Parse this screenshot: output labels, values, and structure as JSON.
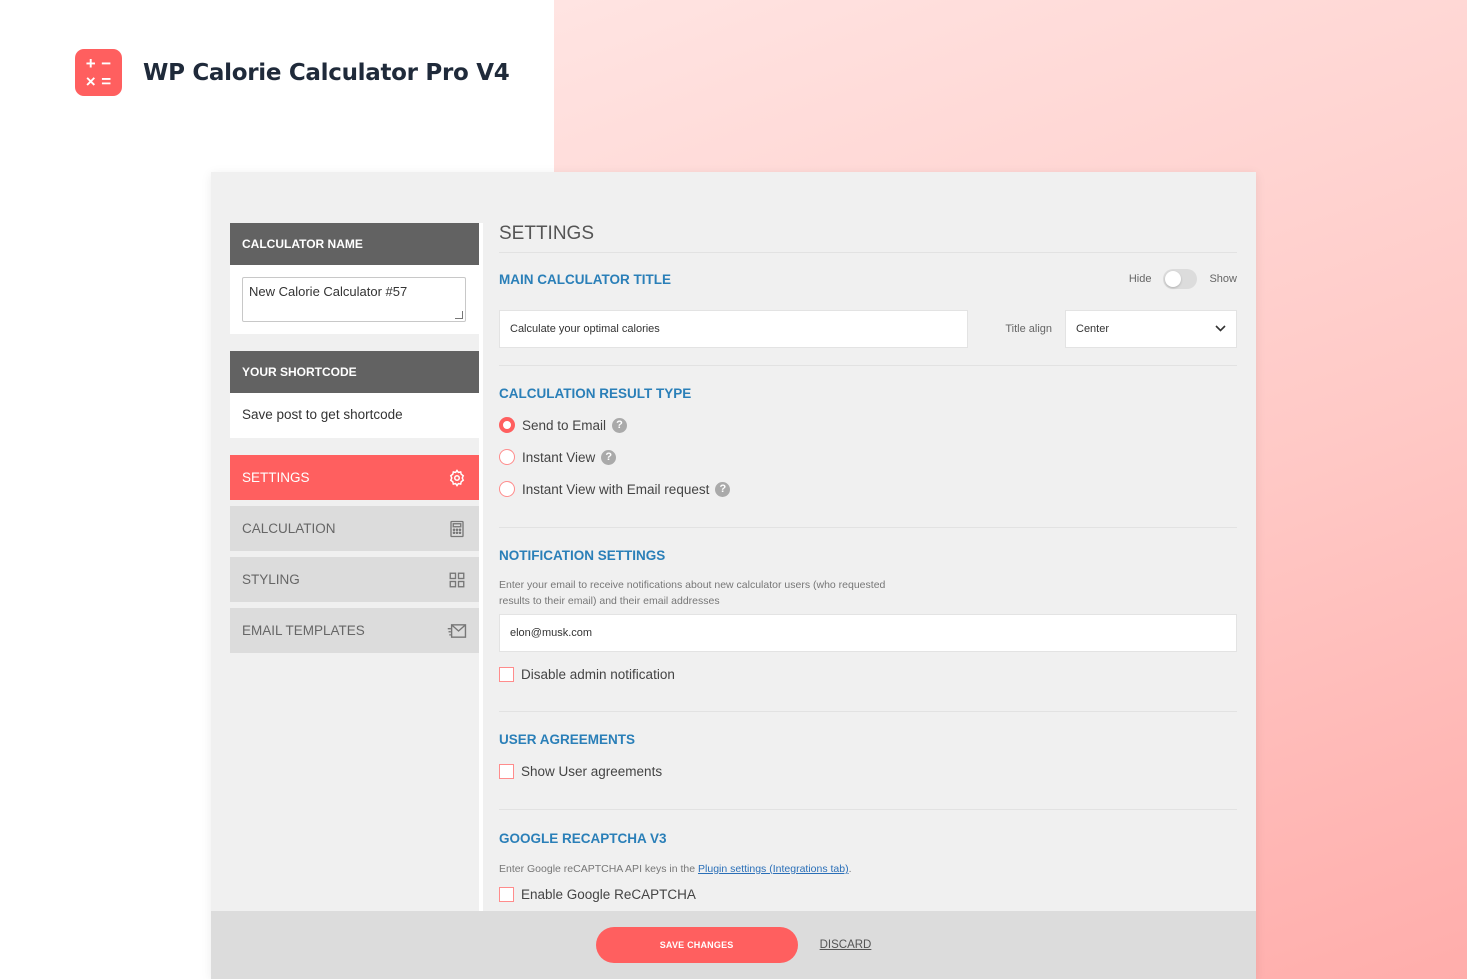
{
  "brand": {
    "title": "WP Calorie Calculator Pro V4",
    "logo_icon": "calculator-icon",
    "logo_color": "#ff5f5f"
  },
  "sidebar": {
    "calculator_name_header": "CALCULATOR NAME",
    "calculator_name_value": "New Calorie Calculator #57",
    "shortcode_header": "YOUR SHORTCODE",
    "shortcode_text": "Save post to get shortcode",
    "nav": [
      {
        "label": "SETTINGS",
        "icon": "gear-icon",
        "active": true
      },
      {
        "label": "CALCULATION",
        "icon": "calculator-icon",
        "active": false
      },
      {
        "label": "STYLING",
        "icon": "grid-icon",
        "active": false
      },
      {
        "label": "EMAIL TEMPLATES",
        "icon": "email-icon",
        "active": false
      }
    ]
  },
  "main": {
    "title": "SETTINGS",
    "main_title_section": {
      "title": "MAIN CALCULATOR TITLE",
      "hide_label": "Hide",
      "show_label": "Show",
      "title_value": "Calculate your optimal calories",
      "align_label": "Title align",
      "align_value": "Center"
    },
    "result_type": {
      "title": "CALCULATION RESULT TYPE",
      "options": [
        {
          "label": "Send to Email",
          "selected": true
        },
        {
          "label": "Instant View",
          "selected": false
        },
        {
          "label": "Instant View with Email request",
          "selected": false
        }
      ]
    },
    "notification": {
      "title": "NOTIFICATION SETTINGS",
      "description_line1": "Enter your email to receive notifications about new calculator users (who requested",
      "description_line2": "results to their email) and their email addresses",
      "email_value": "elon@musk.com",
      "disable_label": "Disable admin notification"
    },
    "agreements": {
      "title": "USER AGREEMENTS",
      "show_label": "Show User agreements"
    },
    "recaptcha": {
      "title": "GOOGLE RECAPTCHA V3",
      "description_prefix": "Enter Google reCAPTCHA API keys in the ",
      "description_link": "Plugin settings (Integrations tab)",
      "description_suffix": ".",
      "enable_label": "Enable Google ReCAPTCHA"
    }
  },
  "footer": {
    "save_label": "SAVE CHANGES",
    "discard_label": "DISCARD"
  },
  "colors": {
    "accent": "#ff5f5f",
    "section_title": "#2a7fb8",
    "header_gray": "#626262"
  }
}
